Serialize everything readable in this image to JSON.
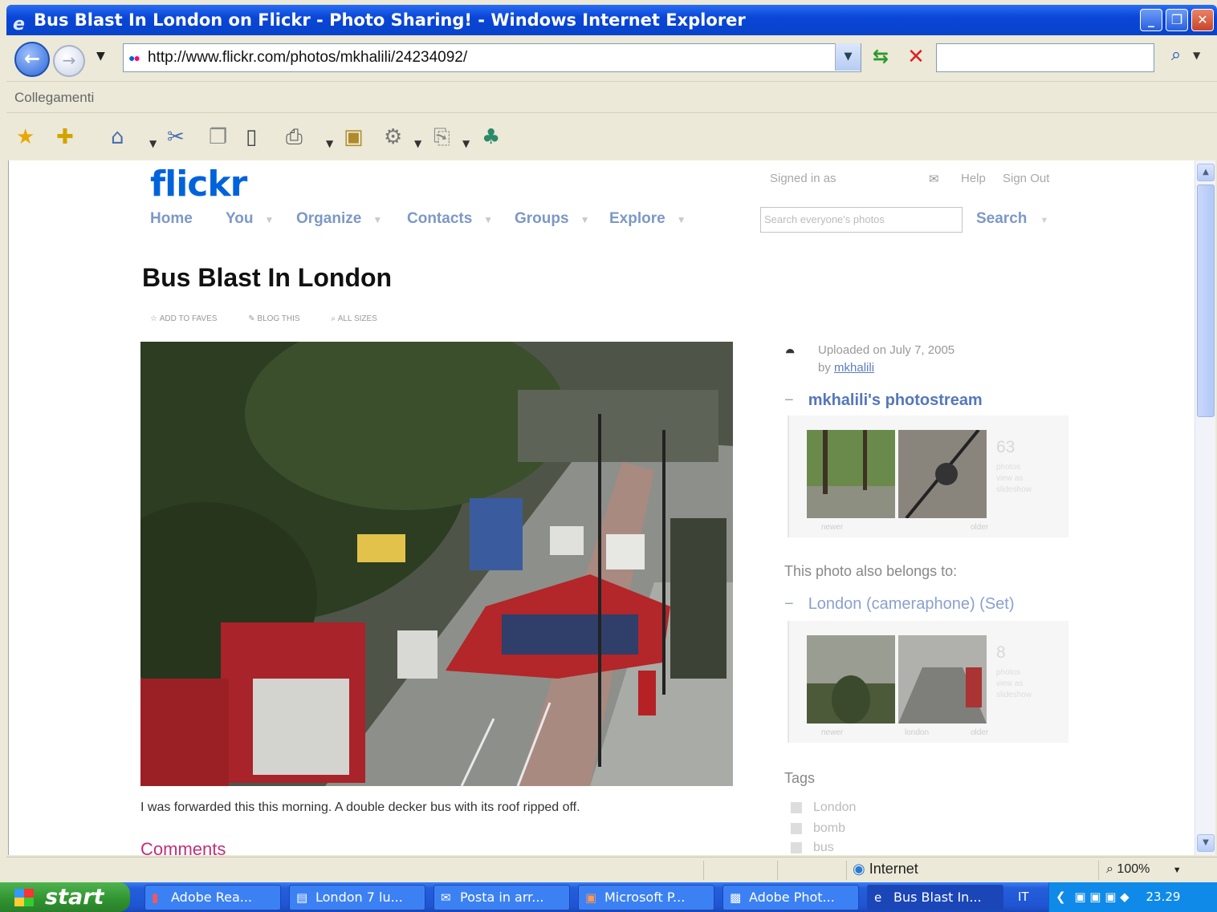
{
  "window": {
    "title": "Bus Blast In London on Flickr - Photo Sharing! - Windows Internet Explorer",
    "controls": [
      "minimize",
      "restore",
      "close"
    ]
  },
  "addressbar": {
    "url": "http://www.flickr.com/photos/mkhalili/24234092/",
    "search_value": ""
  },
  "linksbar": {
    "label": "Collegamenti"
  },
  "commandbar": {
    "icons": [
      "favorites-star-icon",
      "add-favorites-icon",
      "home-icon",
      "cut-icon",
      "copy-icon",
      "paste-icon",
      "print-icon",
      "research-icon",
      "tools-gear-icon",
      "page-icon",
      "messenger-icon"
    ]
  },
  "flickr": {
    "logo_main": "flickr",
    "logo_accent": "",
    "nav": [
      "Home",
      "You",
      "Organize",
      "Contacts",
      "Groups",
      "Explore"
    ],
    "signed_in": "Signed in as",
    "help": "Help",
    "sign_out": "Sign Out",
    "search_placeholder": "Search everyone's photos",
    "search_button": "Search"
  },
  "photo": {
    "title": "Bus Blast In London",
    "actions": [
      "ADD TO FAVES",
      "BLOG THIS",
      "ALL SIZES"
    ],
    "caption": "I was forwarded this this morning. A double decker bus with its roof ripped off.",
    "comments_heading": "Comments"
  },
  "sidebar": {
    "uploaded_line": "Uploaded on July 7, 2005",
    "by_label": "by",
    "author": "mkhalili",
    "photostream_title": "mkhalili's photostream",
    "photostream_count": "63",
    "photostream_sub": [
      "photos",
      "view as",
      "slideshow"
    ],
    "photostream_thumb_labels": [
      "newer",
      "",
      "older"
    ],
    "also_belongs": "This photo also belongs to:",
    "set_title": "London (cameraphone) (Set)",
    "set_count": "8",
    "set_sub": [
      "photos",
      "view as",
      "slideshow"
    ],
    "set_thumb_labels": [
      "newer",
      "london",
      "older"
    ],
    "tags_heading": "Tags",
    "tags": [
      "London",
      "bomb",
      "bus"
    ]
  },
  "statusbar": {
    "zone": "Internet",
    "zoom": "100%"
  },
  "taskbar": {
    "start": "start",
    "tasks": [
      "Adobe Rea...",
      "London 7 lu...",
      "Posta in arr...",
      "Microsoft P...",
      "Adobe Phot...",
      "Bus Blast In..."
    ],
    "lang": "IT",
    "clock": "23.29"
  }
}
